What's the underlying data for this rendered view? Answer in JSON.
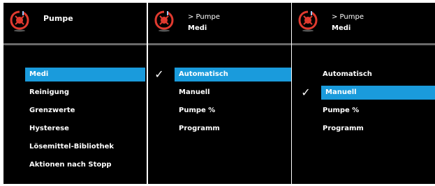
{
  "screens": [
    {
      "header_title": "Pumpe",
      "menu_items": [
        "Medi",
        "Reinigung",
        "Grenzwerte",
        "Hysterese",
        "Lösemittel-Bibliothek",
        "Aktionen nach Stopp"
      ],
      "selected_index": 0
    },
    {
      "breadcrumb": "> Pumpe",
      "header_subtitle": "Medi",
      "menu_items": [
        "Automatisch",
        "Manuell",
        "Pumpe %",
        "Programm"
      ],
      "selected_index": 0,
      "checked_index": 0
    },
    {
      "breadcrumb": "> Pumpe",
      "header_subtitle": "Medi",
      "menu_items": [
        "Automatisch",
        "Manuell",
        "Pumpe %",
        "Programm"
      ],
      "selected_index": 1,
      "checked_index": 1
    }
  ],
  "icons": {
    "pump": "pump-icon",
    "check": "checkmark-icon"
  },
  "colors": {
    "selection": "#1a9bdc",
    "pump_icon": "#e03a2f",
    "background": "#000000"
  }
}
